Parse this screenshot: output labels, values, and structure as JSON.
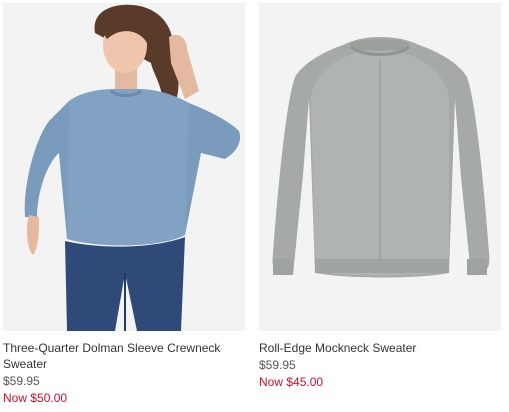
{
  "products": [
    {
      "name": "Three-Quarter Dolman Sleeve Crewneck Sweater",
      "price": "$59.95",
      "sale_price": "Now $50.00",
      "image_icon": "model-wearing-blue-sweater"
    },
    {
      "name": "Roll-Edge Mockneck Sweater",
      "price": "$59.95",
      "sale_price": "Now $45.00",
      "image_icon": "grey-sweater-flat"
    }
  ],
  "colors": {
    "sale": "#c8102e",
    "text": "#333333",
    "image_bg": "#f2f2f2"
  }
}
